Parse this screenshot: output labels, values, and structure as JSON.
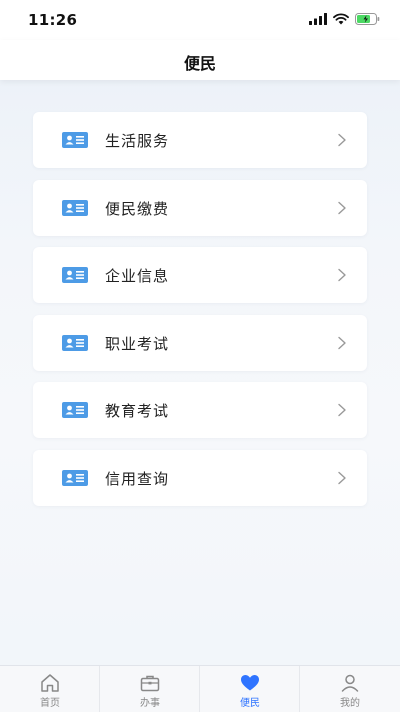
{
  "status_bar": {
    "time": "11:26"
  },
  "header": {
    "title": "便民"
  },
  "menu": {
    "items": [
      {
        "label": "生活服务"
      },
      {
        "label": "便民缴费"
      },
      {
        "label": "企业信息"
      },
      {
        "label": "职业考试"
      },
      {
        "label": "教育考试"
      },
      {
        "label": "信用查询"
      }
    ]
  },
  "tabbar": {
    "tabs": [
      {
        "label": "首页",
        "icon": "home-icon"
      },
      {
        "label": "办事",
        "icon": "briefcase-icon"
      },
      {
        "label": "便民",
        "icon": "heart-icon",
        "active": true
      },
      {
        "label": "我的",
        "icon": "user-icon"
      }
    ]
  },
  "colors": {
    "accent": "#2f74ff",
    "icon_blue": "#4d9be6",
    "inactive": "#888888"
  }
}
